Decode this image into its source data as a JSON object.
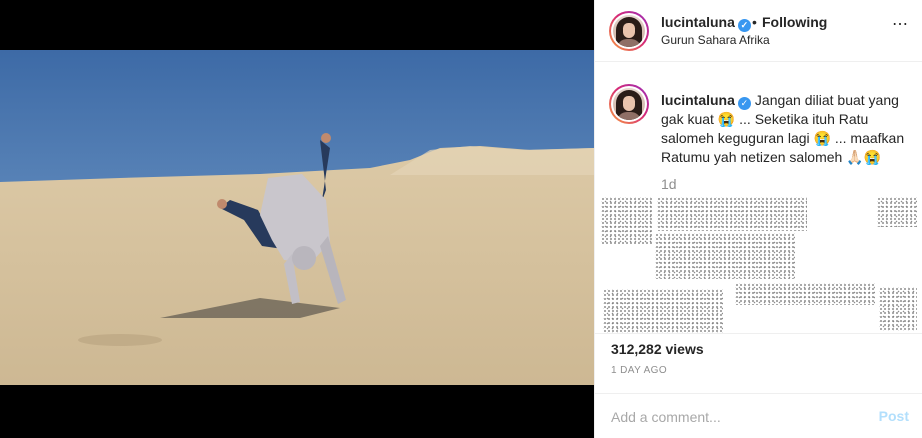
{
  "post": {
    "username": "lucintaluna",
    "separator": "•",
    "follow_status": "Following",
    "location": "Gurun Sahara Afrika",
    "more_icon": "more-horizontal-icon",
    "caption_text": "Jangan diliat buat yang gak kuat 😭 ... Seketika ituh Ratu salomeh keguguran lagi 😭 ... maafkan Ratumu yah netizen salomeh 🙏🏻😭",
    "time_ago": "1d",
    "views": "312,282 views",
    "date": "1 DAY AGO"
  },
  "add_comment": {
    "placeholder": "Add a comment...",
    "post_label": "Post"
  },
  "colors": {
    "verified": "#3897f0",
    "post_button": "#b2dffc",
    "sky": "#4a79b3",
    "sand": "#d9c8aa"
  }
}
